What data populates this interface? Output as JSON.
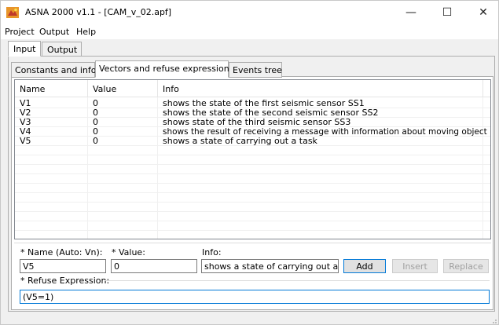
{
  "window": {
    "title": "ASNA 2000 v1.1 - [CAM_v_02.apf]",
    "minimize_glyph": "—",
    "maximize_glyph": "☐",
    "close_glyph": "✕"
  },
  "menu": [
    "Project",
    "Output",
    "Help"
  ],
  "outer_tabs": [
    "Input",
    "Output"
  ],
  "inner_tabs": [
    "Constants and info",
    "Vectors and refuse expression",
    "Events tree"
  ],
  "table": {
    "columns": [
      "Name",
      "Value",
      "Info"
    ],
    "rows": [
      {
        "name": "V1",
        "value": "0",
        "info": "shows the state of the first seismic sensor SS1"
      },
      {
        "name": "V2",
        "value": "0",
        "info": "shows the state of the second seismic sensor SS2"
      },
      {
        "name": "V3",
        "value": "0",
        "info": "shows state of the third seismic sensor SS3"
      },
      {
        "name": "V4",
        "value": "0",
        "info": "shows the result of receiving a message with information about moving object"
      },
      {
        "name": "V5",
        "value": "0",
        "info": "shows a state of carrying out a task"
      }
    ]
  },
  "editor": {
    "name_label": "* Name (Auto: Vn):",
    "name_value": "V5",
    "value_label": "* Value:",
    "value_value": "0",
    "info_label": "Info:",
    "info_value": "shows a state of carrying out a t",
    "add_label": "Add",
    "insert_label": "Insert",
    "replace_label": "Replace",
    "refuse_label": "* Refuse Expression:",
    "refuse_value": "(V5=1)"
  },
  "colors": {
    "accent": "#0078d7",
    "app_icon": "#e8952a"
  }
}
